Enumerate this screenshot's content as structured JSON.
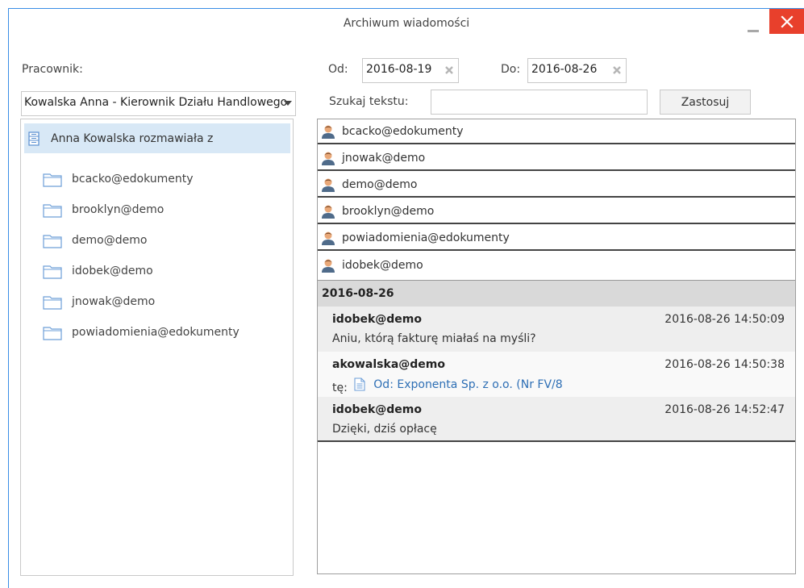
{
  "window": {
    "title": "Archiwum wiadomości"
  },
  "filters": {
    "employee_label": "Pracownik:",
    "employee_value": "Kowalska Anna - Kierownik Działu Handlowego",
    "from_label": "Od:",
    "from_value": "2016-08-19",
    "to_label": "Do:",
    "to_value": "2016-08-26",
    "search_label": "Szukaj tekstu:",
    "search_value": "",
    "apply_label": "Zastosuj"
  },
  "tree": {
    "root": "Anna Kowalska rozmawiała z",
    "items": [
      "bcacko@edokumenty",
      "brooklyn@demo",
      "demo@demo",
      "idobek@demo",
      "jnowak@demo",
      "powiadomienia@edokumenty"
    ]
  },
  "contacts": [
    "bcacko@edokumenty",
    "jnowak@demo",
    "demo@demo",
    "brooklyn@demo",
    "powiadomienia@edokumenty",
    "idobek@demo"
  ],
  "conversation": {
    "date": "2016-08-26",
    "messages": [
      {
        "sender": "idobek@demo",
        "time": "2016-08-26 14:50:09",
        "text": "Aniu, którą fakturę miałaś na myśli?"
      },
      {
        "sender": "akowalska@demo",
        "time": "2016-08-26 14:50:38",
        "prefix": "tę:",
        "attachment": "Od: Exponenta Sp. z o.o. (Nr FV/8"
      },
      {
        "sender": "idobek@demo",
        "time": "2016-08-26 14:52:47",
        "text": "Dzięki, dziś opłacę"
      }
    ]
  },
  "colors": {
    "accent": "#3a8ee6",
    "close": "#e8402c",
    "selected": "#d8e8f6",
    "link": "#2e6fb5"
  }
}
